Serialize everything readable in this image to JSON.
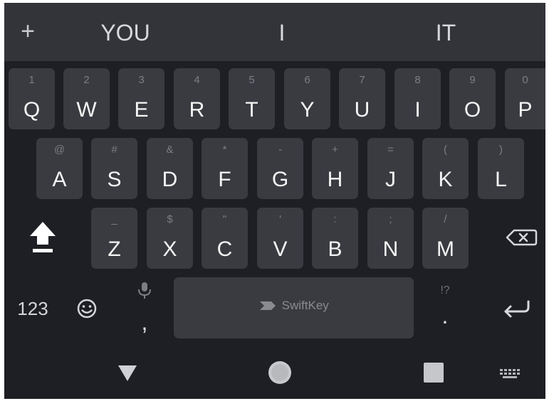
{
  "suggestions": {
    "add": "+",
    "left": "YOU",
    "center": "I",
    "right": "IT"
  },
  "rows": {
    "row1": [
      {
        "key": "Q",
        "hint": "1"
      },
      {
        "key": "W",
        "hint": "2"
      },
      {
        "key": "E",
        "hint": "3"
      },
      {
        "key": "R",
        "hint": "4"
      },
      {
        "key": "T",
        "hint": "5"
      },
      {
        "key": "Y",
        "hint": "6"
      },
      {
        "key": "U",
        "hint": "7"
      },
      {
        "key": "I",
        "hint": "8"
      },
      {
        "key": "O",
        "hint": "9"
      },
      {
        "key": "P",
        "hint": "0"
      }
    ],
    "row2": [
      {
        "key": "A",
        "hint": "@"
      },
      {
        "key": "S",
        "hint": "#"
      },
      {
        "key": "D",
        "hint": "&"
      },
      {
        "key": "F",
        "hint": "*"
      },
      {
        "key": "G",
        "hint": "-"
      },
      {
        "key": "H",
        "hint": "+"
      },
      {
        "key": "J",
        "hint": "="
      },
      {
        "key": "K",
        "hint": "("
      },
      {
        "key": "L",
        "hint": ")"
      }
    ],
    "row3": [
      {
        "key": "Z",
        "hint": "_"
      },
      {
        "key": "X",
        "hint": "$"
      },
      {
        "key": "C",
        "hint": "\""
      },
      {
        "key": "V",
        "hint": "'"
      },
      {
        "key": "B",
        "hint": ":"
      },
      {
        "key": "N",
        "hint": ";"
      },
      {
        "key": "M",
        "hint": "/"
      }
    ]
  },
  "bottom": {
    "numbers": "123",
    "comma": ",",
    "period": ".",
    "period_hint": "!?",
    "spacebar_brand": "SwiftKey"
  },
  "colors": {
    "background": "#1e1f24",
    "key": "#3a3b41",
    "suggestion_bar": "#33343a",
    "text": "#f5f5f5",
    "hint": "#7d7e84"
  },
  "icons": {
    "shift": "shift-icon",
    "backspace": "backspace-icon",
    "emoji": "emoji-icon",
    "mic": "microphone-icon",
    "enter": "enter-icon",
    "nav_back": "back-triangle-icon",
    "nav_home": "home-circle-icon",
    "nav_recents": "recents-square-icon",
    "nav_keyboard": "keyboard-switch-icon"
  }
}
